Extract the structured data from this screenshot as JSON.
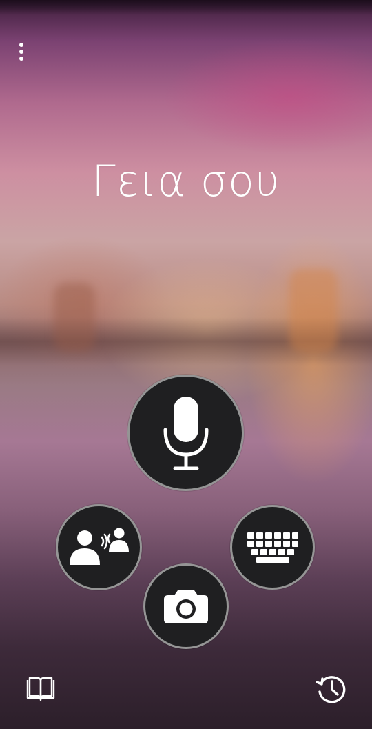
{
  "app": {
    "greeting_text": "Γεια σου"
  },
  "icons": {
    "menu": "more-vertical-icon",
    "microphone": "microphone-icon",
    "conversation": "conversation-icon",
    "keyboard": "keyboard-icon",
    "camera": "camera-icon",
    "phrasebook": "phrasebook-icon",
    "history": "history-icon"
  },
  "colors": {
    "button_fill": "#1f1f21",
    "button_ring": "#c8c8c8",
    "icon": "#ffffff"
  }
}
